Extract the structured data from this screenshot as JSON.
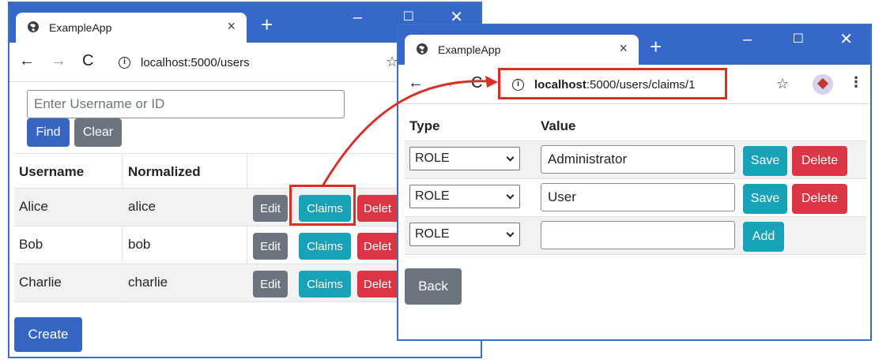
{
  "back_window": {
    "tab_title": "ExampleApp",
    "url": "localhost:5000/users",
    "search_placeholder": "Enter Username or ID",
    "find_label": "Find",
    "clear_label": "Clear",
    "table_headers": [
      "Username",
      "Normalized"
    ],
    "rows": [
      {
        "username": "Alice",
        "normalized": "alice"
      },
      {
        "username": "Bob",
        "normalized": "bob"
      },
      {
        "username": "Charlie",
        "normalized": "charlie"
      }
    ],
    "edit_label": "Edit",
    "claims_label": "Claims",
    "delete_label": "Delet",
    "create_label": "Create"
  },
  "front_window": {
    "tab_title": "ExampleApp",
    "url_host": "localhost",
    "url_rest": ":5000/users/claims/1",
    "table_headers": [
      "Type",
      "Value"
    ],
    "rows": [
      {
        "type": "ROLE",
        "value": "Administrator",
        "action1": "Save",
        "action2": "Delete"
      },
      {
        "type": "ROLE",
        "value": "User",
        "action1": "Save",
        "action2": "Delete"
      },
      {
        "type": "ROLE",
        "value": "",
        "action1": "Add"
      }
    ],
    "back_label": "Back"
  },
  "colors": {
    "titlebar": "#3568c8",
    "primary": "#3566c4",
    "secondary": "#6c757d",
    "info": "#17a2b8",
    "danger": "#dc3545",
    "annotation": "#d93025"
  }
}
